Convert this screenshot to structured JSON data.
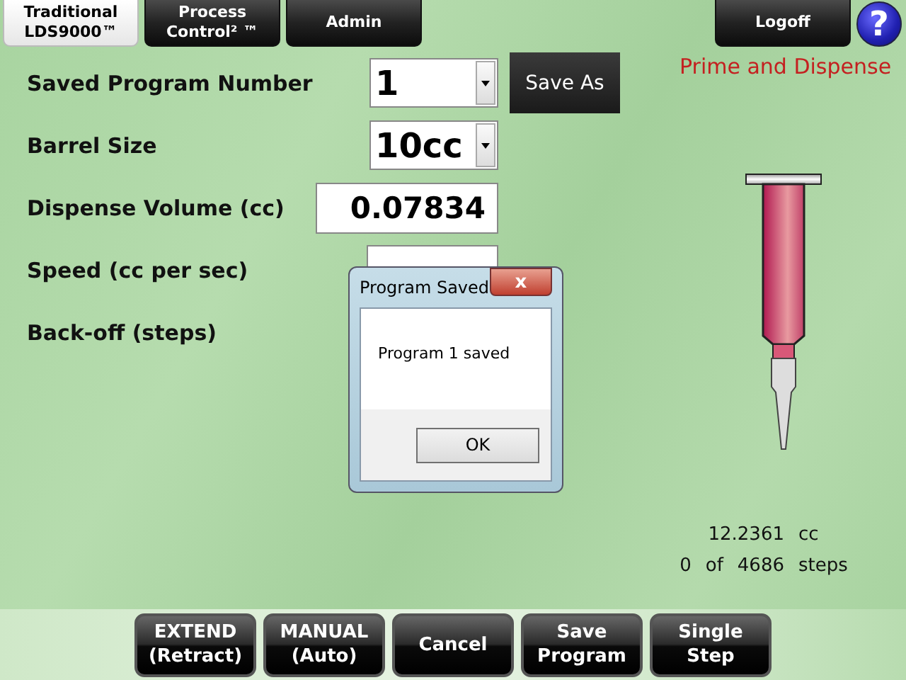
{
  "tabs": [
    {
      "label": "Traditional\nLDS9000™",
      "selected": true
    },
    {
      "label": "Process\nControl² ™",
      "selected": false
    },
    {
      "label": "Admin",
      "selected": false
    }
  ],
  "logoff": "Logoff",
  "help": "?",
  "mode_title": "Prime and Dispense",
  "fields": [
    {
      "label": "Saved Program Number",
      "kind": "select",
      "value": "1",
      "action": "Save As"
    },
    {
      "label": "Barrel Size",
      "kind": "select",
      "value": "10cc"
    },
    {
      "label": "Dispense Volume (cc)",
      "kind": "input",
      "value": "0.07834"
    },
    {
      "label": "Speed (cc per sec)",
      "kind": "input"
    },
    {
      "label": "Back-off (steps)",
      "kind": "none"
    }
  ],
  "readouts": [
    {
      "value": "12.2361",
      "unit": "cc"
    },
    {
      "value": "0",
      "of": "of",
      "total": "4686",
      "unit": "steps"
    }
  ],
  "buttons": [
    "EXTEND\n(Retract)",
    "MANUAL\n(Auto)",
    "Cancel",
    "Save\nProgram",
    "Single\nStep"
  ],
  "dialog": {
    "title": "Program Saved",
    "close": "x",
    "message": "Program 1 saved",
    "ok": "OK"
  }
}
